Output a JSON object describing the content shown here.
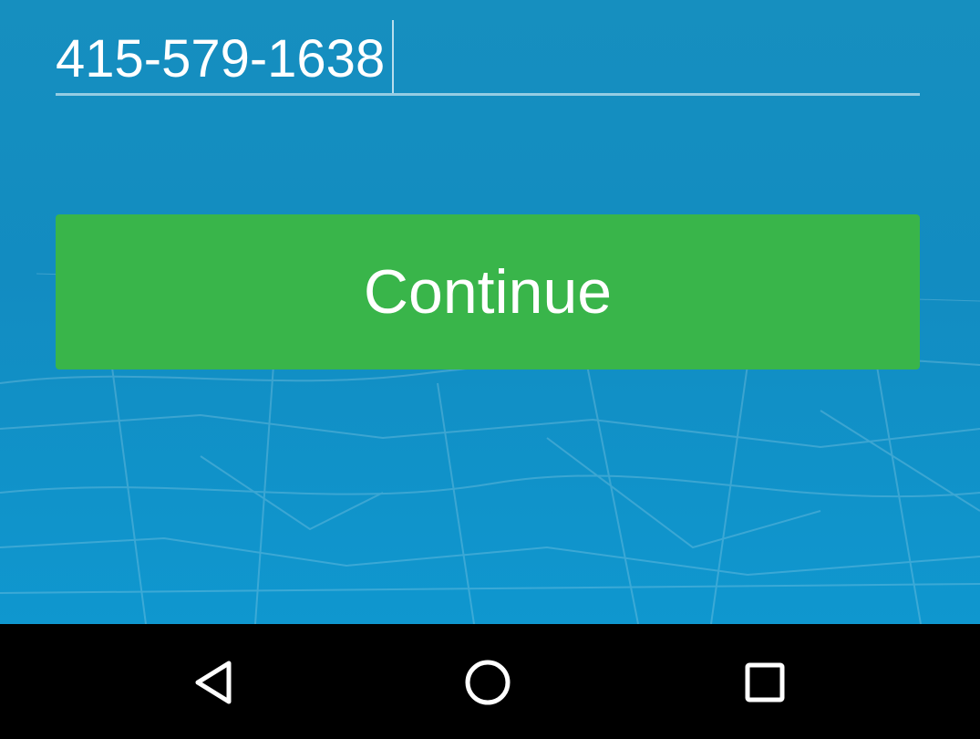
{
  "phone_input": {
    "value": "415-579-1638"
  },
  "continue_button": {
    "label": "Continue",
    "color": "#39b54a"
  },
  "background": {
    "color": "#128cc1"
  },
  "nav_bar": {
    "back_icon": "back-triangle-icon",
    "home_icon": "home-circle-icon",
    "recents_icon": "recents-square-icon"
  }
}
